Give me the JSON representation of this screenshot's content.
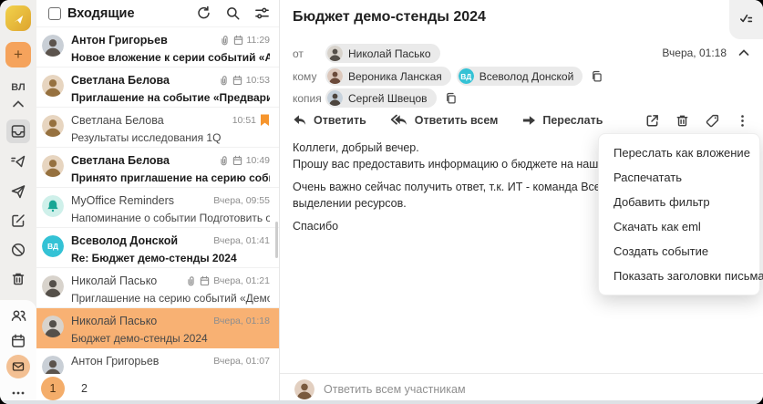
{
  "colors": {
    "accent_orange": "#F5A35C",
    "selected_row": "#F8B173",
    "pagination_circle": "#F4AD6A",
    "flag_orange": "#F6952D",
    "teal": "#34C2D5",
    "reminder_mint": "#CFF0EA",
    "reminder_bell": "#18A695",
    "rail_bg": "#F0EFED"
  },
  "rail": {
    "initials": "ВЛ",
    "icons": [
      "inbox-icon",
      "outbox-icon",
      "sent-icon",
      "drafts-icon",
      "spam-icon",
      "trash-icon",
      "contacts-icon",
      "calendar-icon",
      "mail-icon",
      "more-icon"
    ],
    "selected_icon": "inbox-icon",
    "active_app_icon": "mail-icon"
  },
  "avatars": {
    "anton": {
      "type": "photo",
      "bg": "#C9CFD6",
      "fg": "#5C544D"
    },
    "svetlana": {
      "type": "photo",
      "bg": "#E7D5C0",
      "fg": "#96713F"
    },
    "nikolay": {
      "type": "photo",
      "bg": "#D8D3CC",
      "fg": "#55504A"
    },
    "veronika": {
      "type": "photo",
      "bg": "#DCC8BC",
      "fg": "#6B4A3A"
    },
    "sergey": {
      "type": "photo",
      "bg": "#C7D2DC",
      "fg": "#4E463F"
    },
    "user": {
      "type": "photo",
      "bg": "#E2CFC0",
      "fg": "#7A5A3E"
    },
    "reminders": {
      "type": "bell",
      "bg": "#CFF0EA",
      "fg": "#18A695"
    },
    "vd": {
      "type": "initials",
      "text": "ВД",
      "bg": "#34C2D5",
      "fg": "#FFFFFF"
    }
  },
  "list": {
    "header": {
      "title": "Входящие",
      "icons": [
        "refresh-icon",
        "search-icon",
        "filter-icon"
      ]
    },
    "emails": [
      {
        "from": "Антон Григорьев",
        "subject": "Новое вложение к серии событий «Аналити...",
        "time": "11:29",
        "unread": true,
        "attachment": true,
        "event": true,
        "flagged": false,
        "selected": false,
        "avatar": "anton"
      },
      {
        "from": "Светлана Белова",
        "subject": "Приглашение на событие «Предварительно...",
        "time": "10:53",
        "unread": true,
        "attachment": true,
        "event": true,
        "flagged": false,
        "selected": false,
        "avatar": "svetlana"
      },
      {
        "from": "Светлана Белова",
        "subject": "Результаты исследования 1Q",
        "time": "10:51",
        "unread": false,
        "attachment": false,
        "event": false,
        "flagged": true,
        "selected": false,
        "avatar": "svetlana"
      },
      {
        "from": "Светлана Белова",
        "subject": "Принято приглашение на серию событий «...",
        "time": "10:49",
        "unread": true,
        "attachment": true,
        "event": true,
        "flagged": false,
        "selected": false,
        "avatar": "svetlana"
      },
      {
        "from": "MyOffice Reminders",
        "subject": "Напоминание о событии Подготовить отчет...",
        "time": "Вчера, 09:55",
        "unread": false,
        "attachment": false,
        "event": false,
        "flagged": false,
        "selected": false,
        "avatar": "reminders"
      },
      {
        "from": "Всеволод Донской",
        "subject": "Re: Бюджет демо-стенды 2024",
        "time": "Вчера, 01:41",
        "unread": true,
        "attachment": false,
        "event": false,
        "flagged": false,
        "selected": false,
        "avatar": "vd"
      },
      {
        "from": "Николай Пасько",
        "subject": "Приглашение на серию событий «Демо стен...",
        "time": "Вчера, 01:21",
        "unread": false,
        "attachment": true,
        "event": true,
        "flagged": false,
        "selected": false,
        "avatar": "nikolay"
      },
      {
        "from": "Николай Пасько",
        "subject": "Бюджет демо-стенды 2024",
        "time": "Вчера, 01:18",
        "unread": false,
        "attachment": false,
        "event": false,
        "flagged": false,
        "selected": true,
        "avatar": "nikolay"
      },
      {
        "from": "Антон Григорьев",
        "subject": "",
        "time": "Вчера, 01:07",
        "unread": false,
        "attachment": false,
        "event": false,
        "flagged": false,
        "selected": false,
        "avatar": "anton"
      }
    ],
    "pagination": {
      "current": "1",
      "next": "2"
    }
  },
  "mail": {
    "subject": "Бюджет демо-стенды 2024",
    "date": "Вчера, 01:18",
    "from_label": "от",
    "from": [
      {
        "name": "Николай Пасько",
        "avatar": "nikolay"
      }
    ],
    "to_label": "кому",
    "to": [
      {
        "name": "Вероника Ланская",
        "avatar": "veronika"
      },
      {
        "name": "Всеволод Донской",
        "avatar": "vd"
      }
    ],
    "cc_label": "копия",
    "cc": [
      {
        "name": "Сергей Швецов",
        "avatar": "sergey"
      }
    ],
    "actions": {
      "reply": "Ответить",
      "reply_all": "Ответить всем",
      "forward": "Переслать",
      "icons": [
        "open-in-new-icon",
        "delete-icon",
        "tag-icon",
        "kebab-menu-icon"
      ]
    },
    "body_lines": [
      "Коллеги, добрый вечер.",
      "Прошу вас предоставить информацию о бюджете на наши демонстраци",
      "",
      "Очень важно сейчас получить ответ, т.к. ИТ - команда Всеволода, уже",
      "выделении ресурсов.",
      "",
      "Спасибо"
    ],
    "quick_reply": "Ответить всем участникам"
  },
  "menu": {
    "items": [
      "Переслать как вложение",
      "Распечатать",
      "Добавить фильтр",
      "Скачать как eml",
      "Создать событие",
      "Показать заголовки письма"
    ]
  }
}
